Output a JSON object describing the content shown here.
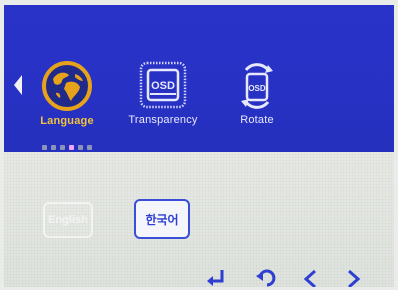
{
  "osd": {
    "menu_items": [
      {
        "label": "Language",
        "icon": "globe-icon",
        "selected": true
      },
      {
        "label": "Transparency",
        "icon": "osd-transparency-icon",
        "selected": false
      },
      {
        "label": "Rotate",
        "icon": "osd-rotate-icon",
        "selected": false
      }
    ],
    "icon_text": "OSD",
    "page_indicator": {
      "total": 6,
      "active_index": 3
    },
    "languages": [
      {
        "label": "English",
        "selected": false
      },
      {
        "label": "한국어",
        "selected": true
      }
    ],
    "controls": [
      {
        "icon": "enter-icon"
      },
      {
        "icon": "return-icon"
      },
      {
        "icon": "left-arrow-icon"
      },
      {
        "icon": "right-arrow-icon"
      }
    ],
    "colors": {
      "panel_blue": "#2731c4",
      "selected_label": "#f3c23b",
      "globe_gold": "#e7a21c",
      "indicator_active": "#f2a6ff"
    }
  }
}
